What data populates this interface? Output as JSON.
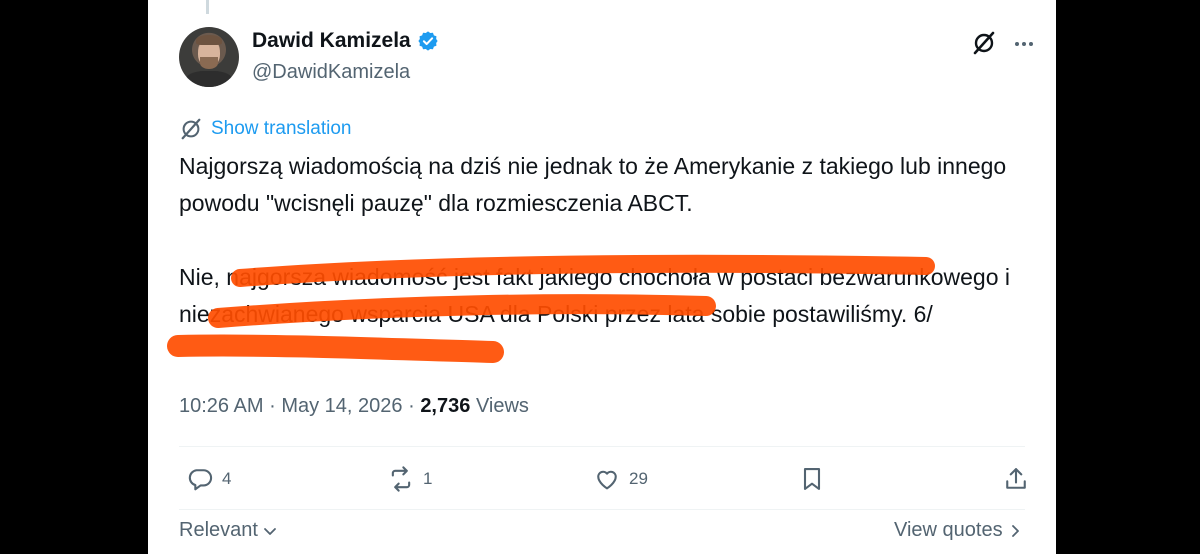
{
  "author": {
    "name": "Dawid Kamizela",
    "handle": "@DawidKamizela",
    "verified": true
  },
  "translation_link": "Show translation",
  "tweet": {
    "paragraph1": "Najgorszą wiadomością na dziś nie jednak to że Amerykanie z takiego lub innego powodu \"wcisnęli pauzę\" dla rozmiesczenia ABCT.",
    "paragraph2": "Nie, najgorsza wiadomość jest fakt jakiego chochoła w postaci bezwarunkowego i niezachwianego wsparcia USA dla Polski przez lata sobie postawiliśmy. 6/"
  },
  "meta": {
    "time": "10:26 AM",
    "separator": "·",
    "date": "May 14, 2026",
    "views_count": "2,736",
    "views_label": "Views"
  },
  "actions": {
    "replies": "4",
    "reposts": "1",
    "likes": "29"
  },
  "footer": {
    "sort_label": "Relevant",
    "view_quotes": "View quotes"
  },
  "colors": {
    "accent": "#1d9bf0",
    "highlight_marker": "#ff4d00",
    "text": "#0f1419",
    "muted": "#536471"
  },
  "icons": [
    "verified-badge-icon",
    "grok-icon",
    "more-icon",
    "translate-icon",
    "reply-icon",
    "repost-icon",
    "like-icon",
    "bookmark-icon",
    "share-icon",
    "chevron-down-icon",
    "chevron-right-icon"
  ]
}
